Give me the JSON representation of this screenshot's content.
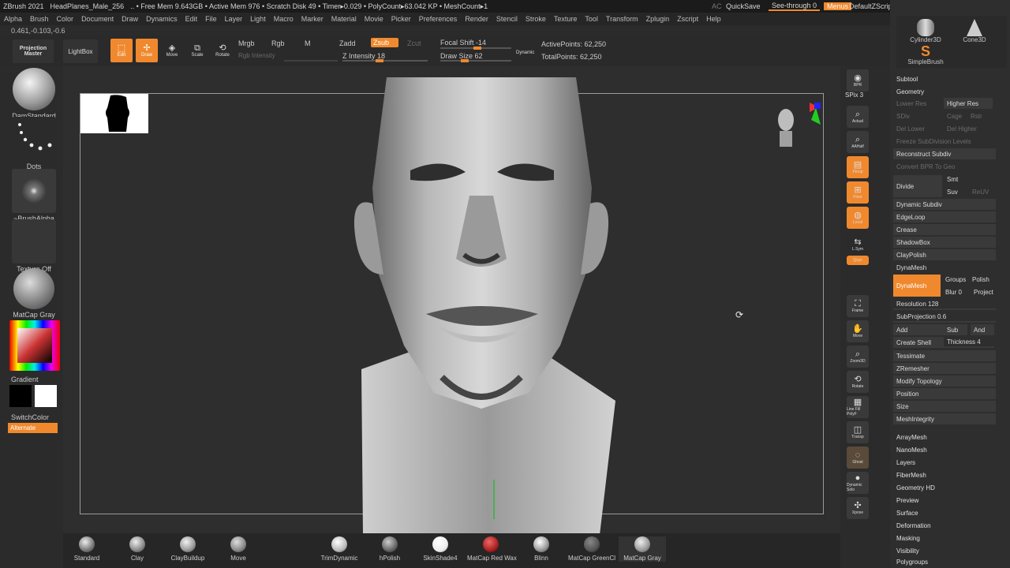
{
  "title": {
    "app": "ZBrush 2021",
    "project": "HeadPlanes_Male_256",
    "stats": ".. • Free Mem 9.643GB • Active Mem 976 • Scratch Disk 49 • Timer▸0.029 • PolyCount▸63.042 KP • MeshCount▸1",
    "ac": "AC",
    "quicksave": "QuickSave",
    "seethrough": "See-through  0",
    "menus": "Menus",
    "script": "DefaultZScript"
  },
  "menu": [
    "Alpha",
    "Brush",
    "Color",
    "Document",
    "Draw",
    "Dynamics",
    "Edit",
    "File",
    "Layer",
    "Light",
    "Macro",
    "Marker",
    "Material",
    "Movie",
    "Picker",
    "Preferences",
    "Render",
    "Stencil",
    "Stroke",
    "Texture",
    "Tool",
    "Transform",
    "Zplugin",
    "Zscript",
    "Help"
  ],
  "coords": "0.461,-0.103,-0.6",
  "toolbar": {
    "projection_master": "Projection Master",
    "lightbox": "LightBox",
    "edit": "Edit",
    "draw": "Draw",
    "move": "Move",
    "scale": "Scale",
    "rotate": "Rotate",
    "mrgb": "Mrgb",
    "rgb": "Rgb",
    "m": "M",
    "rgb_intensity": "Rgb Intensity",
    "zadd": "Zadd",
    "zsub": "Zsub",
    "zcut": "Zcut",
    "z_intensity": "Z Intensity 18",
    "focal_shift": "Focal Shift -14",
    "draw_size": "Draw Size 62",
    "dynamic": "Dynamic",
    "active_points": "ActivePoints: 62,250",
    "total_points": "TotalPoints: 62,250"
  },
  "left": {
    "brush": "DamStandard",
    "stroke": "Dots",
    "alpha": "~BrushAlpha",
    "texture": "Texture Off",
    "material": "MatCap Gray",
    "gradient": "Gradient",
    "switch": "SwitchColor",
    "alternate": "Alternate"
  },
  "shelf": [
    {
      "id": "bpr",
      "label": "BPR"
    },
    {
      "id": "spix",
      "label": "SPix 3"
    },
    {
      "id": "actual",
      "label": "Actual"
    },
    {
      "id": "aahalf",
      "label": "AAHalf"
    },
    {
      "id": "persp",
      "label": "Persp"
    },
    {
      "id": "floor",
      "label": "Floor"
    },
    {
      "id": "local",
      "label": "Local"
    },
    {
      "id": "lsym",
      "label": "L.Sym"
    },
    {
      "id": "xyz",
      "label": "Qxyz"
    },
    {
      "id": "frame",
      "label": "Frame"
    },
    {
      "id": "move",
      "label": "Move"
    },
    {
      "id": "zoom3d",
      "label": "Zoom3D"
    },
    {
      "id": "rotate",
      "label": "Rotate"
    },
    {
      "id": "polyf",
      "label": "Line Fill PolyF"
    },
    {
      "id": "transp",
      "label": "Transp"
    },
    {
      "id": "ghost",
      "label": "Ghost"
    },
    {
      "id": "solo",
      "label": "Dynamic Solo"
    },
    {
      "id": "xpose",
      "label": "Xpose"
    }
  ],
  "tools": {
    "cylinder": "Cylinder3D",
    "cone": "Cone3D",
    "simplebrush": "SimpleBrush"
  },
  "subtool": "Subtool",
  "geometry": {
    "title": "Geometry",
    "lower_res": "Lower Res",
    "higher_res": "Higher Res",
    "sdiv": "SDiv",
    "cage": "Cage",
    "rstr": "Rstr",
    "del_lower": "Del Lower",
    "del_higher": "Del Higher",
    "freeze": "Freeze SubDivision Levels",
    "reconstruct": "Reconstruct Subdiv",
    "convert": "Convert BPR To Geo",
    "divide": "Divide",
    "smt": "Smt",
    "suv": "Suv",
    "reuv": "ReUV",
    "dynamic_subdiv": "Dynamic Subdiv",
    "edgeloop": "EdgeLoop",
    "crease": "Crease",
    "shadowbox": "ShadowBox",
    "claypolish": "ClayPolish",
    "dynamesh_head": "DynaMesh",
    "dynamesh": "DynaMesh",
    "groups": "Groups",
    "polish": "Polish",
    "blur": "Blur 0",
    "project": "Project",
    "resolution": "Resolution 128",
    "subprojection": "SubProjection 0.6",
    "add": "Add",
    "sub": "Sub",
    "and": "And",
    "create_shell": "Create Shell",
    "thickness": "Thickness 4",
    "tessimate": "Tessimate",
    "zremesher": "ZRemesher",
    "modify_topology": "Modify Topology",
    "position": "Position",
    "size": "Size",
    "meshintegrity": "MeshIntegrity"
  },
  "sections": [
    "ArrayMesh",
    "NanoMesh",
    "Layers",
    "FiberMesh",
    "Geometry HD",
    "Preview",
    "Surface",
    "Deformation",
    "Masking",
    "Visibility",
    "Polygroups"
  ],
  "materials": [
    {
      "name": "Standard",
      "color": "#9a9a9a"
    },
    {
      "name": "Clay",
      "color": "#b0b0b0"
    },
    {
      "name": "ClayBuildup",
      "color": "#c0c0c0"
    },
    {
      "name": "Move",
      "color": "#a8a8a8"
    },
    {
      "name": "TrimDynamic",
      "color": "#d0d0d0"
    },
    {
      "name": "hPolish",
      "color": "#8a8a8a"
    },
    {
      "name": "SkinShade4",
      "color": "#f0f0f0"
    },
    {
      "name": "MatCap Red Wax",
      "color": "#b02a20"
    },
    {
      "name": "Blinn",
      "color": "#c8c8c8"
    },
    {
      "name": "MatCap GreenCl",
      "color": "#5a5e58"
    },
    {
      "name": "MatCap Gray",
      "color": "#b8b8b8"
    }
  ]
}
